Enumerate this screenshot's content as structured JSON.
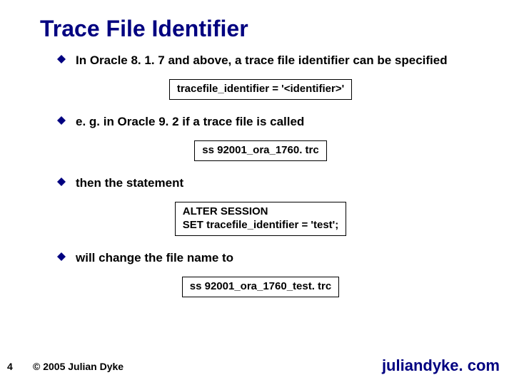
{
  "title": "Trace File Identifier",
  "bullets": [
    {
      "text": "In Oracle 8. 1. 7 and above, a trace file identifier can be specified"
    },
    {
      "text": "e. g. in Oracle 9. 2 if a trace file is called"
    },
    {
      "text": "then the statement"
    },
    {
      "text": "will change the file name to"
    }
  ],
  "codeboxes": [
    "tracefile_identifier = '<identifier>'",
    "ss 92001_ora_1760. trc",
    "ALTER SESSION\nSET tracefile_identifier = 'test';",
    "ss 92001_ora_1760_test. trc"
  ],
  "footer": {
    "page": "4",
    "copyright": "© 2005 Julian Dyke",
    "site": "juliandyke. com"
  },
  "colors": {
    "accent": "#000080"
  }
}
